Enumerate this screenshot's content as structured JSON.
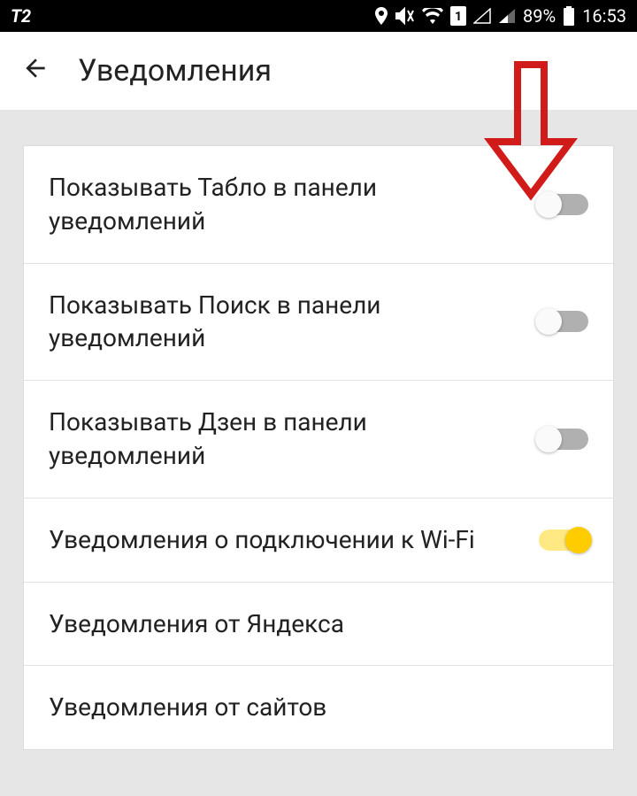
{
  "status_bar": {
    "carrier": "T2",
    "battery_pct": "89%",
    "time": "16:53",
    "icons": [
      "location",
      "mute",
      "wifi",
      "sim1",
      "signal-empty",
      "signal-half"
    ]
  },
  "header": {
    "title": "Уведомления"
  },
  "settings": [
    {
      "id": "tablo-toggle",
      "label": "Показывать Табло в панели уведомлений",
      "has_toggle": true,
      "on": false
    },
    {
      "id": "search-toggle",
      "label": "Показывать Поиск в панели уведомлений",
      "has_toggle": true,
      "on": false
    },
    {
      "id": "zen-toggle",
      "label": "Показывать Дзен в панели уведомлений",
      "has_toggle": true,
      "on": false
    },
    {
      "id": "wifi-toggle",
      "label": "Уведомления о подключении к Wi-Fi",
      "has_toggle": true,
      "on": true
    },
    {
      "id": "yandex-notifications",
      "label": "Уведомления от Яндекса",
      "has_toggle": false
    },
    {
      "id": "site-notifications",
      "label": "Уведомления от сайтов",
      "has_toggle": false
    }
  ],
  "annotation": {
    "arrow_color": "#d11a1a"
  }
}
